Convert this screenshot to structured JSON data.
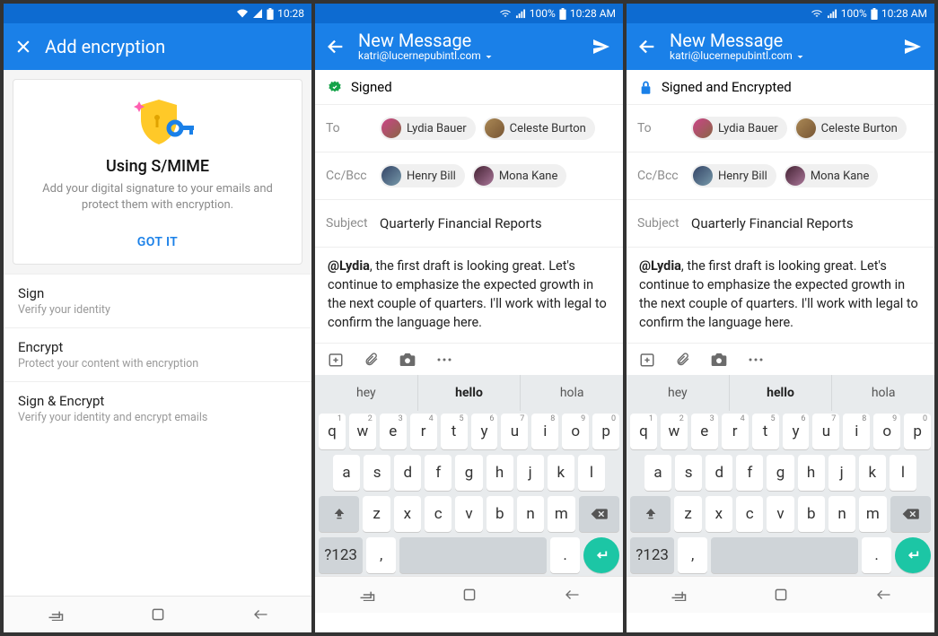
{
  "status1": {
    "time": "10:28"
  },
  "status2": {
    "batt": "100%",
    "time": "10:28 AM"
  },
  "p1": {
    "appbar_title": "Add encryption",
    "card_title": "Using S/MIME",
    "card_sub": "Add your digital signature to your emails and protect them with encryption.",
    "card_btn": "GOT IT",
    "opts": [
      {
        "t": "Sign",
        "s": "Verify your identity"
      },
      {
        "t": "Encrypt",
        "s": "Protect your content with encryption"
      },
      {
        "t": "Sign & Encrypt",
        "s": "Verify your identity and encrypt emails"
      }
    ]
  },
  "compose": {
    "appbar_title": "New Message",
    "from": "katri@lucernepubintl.com",
    "to_label": "To",
    "cc_label": "Cc/Bcc",
    "subject_label": "Subject",
    "subject": "Quarterly Financial Reports",
    "body_mention": "@Lydia",
    "body_rest": ", the first draft is looking great. Let's continue to emphasize the expected growth in the next couple of quarters. I'll work with legal to confirm the language here.",
    "to": [
      {
        "name": "Lydia Bauer"
      },
      {
        "name": "Celeste Burton"
      }
    ],
    "cc": [
      {
        "name": "Henry Bill"
      },
      {
        "name": "Mona Kane"
      }
    ]
  },
  "p2": {
    "status_text": "Signed"
  },
  "p3": {
    "status_text": "Signed and Encrypted"
  },
  "kbd": {
    "suggest": [
      "hey",
      "hello",
      "hola"
    ],
    "row1": [
      "q",
      "w",
      "e",
      "r",
      "t",
      "y",
      "u",
      "i",
      "o",
      "p"
    ],
    "nums": [
      "1",
      "2",
      "3",
      "4",
      "5",
      "6",
      "7",
      "8",
      "9",
      "0"
    ],
    "row2": [
      "a",
      "s",
      "d",
      "f",
      "g",
      "h",
      "j",
      "k",
      "l"
    ],
    "row3": [
      "z",
      "x",
      "c",
      "v",
      "b",
      "n",
      "m"
    ],
    "symkey": "?123",
    "comma": ",",
    "period": "."
  }
}
